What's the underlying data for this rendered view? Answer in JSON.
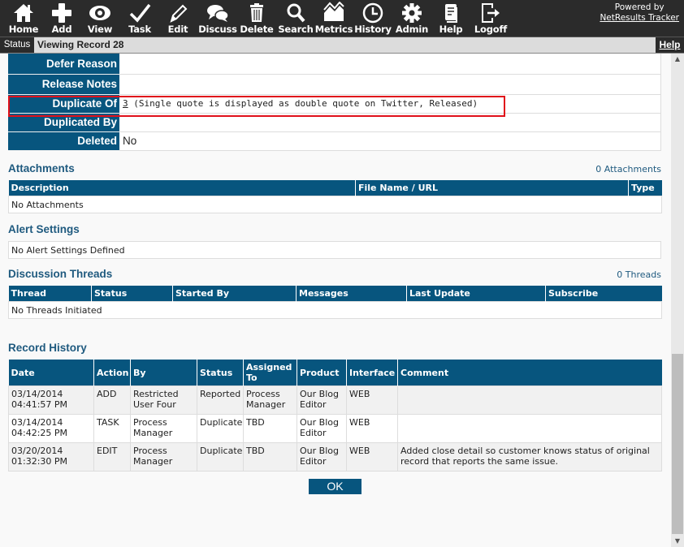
{
  "toolbar": {
    "items": [
      {
        "label": "Home",
        "icon": "home-icon"
      },
      {
        "label": "Add",
        "icon": "plus-icon"
      },
      {
        "label": "View",
        "icon": "eye-icon"
      },
      {
        "label": "Task",
        "icon": "checkmark-icon"
      },
      {
        "label": "Edit",
        "icon": "pencil-icon"
      },
      {
        "label": "Discuss",
        "icon": "chat-bubbles-icon"
      },
      {
        "label": "Delete",
        "icon": "trash-icon"
      },
      {
        "label": "Search",
        "icon": "magnifier-icon"
      },
      {
        "label": "Metrics",
        "icon": "chart-icon"
      },
      {
        "label": "History",
        "icon": "clock-icon"
      },
      {
        "label": "Admin",
        "icon": "gear-icon"
      },
      {
        "label": "Help",
        "icon": "document-icon"
      },
      {
        "label": "Logoff",
        "icon": "logout-icon"
      }
    ],
    "powered_by": "Powered by",
    "brand_link": "NetResults Tracker"
  },
  "statusbar": {
    "tag": "Status",
    "text": "Viewing Record 28",
    "help": "Help"
  },
  "fields": [
    {
      "label": "Defer Reason",
      "value": ""
    },
    {
      "label": "Release Notes",
      "value": ""
    },
    {
      "label": "Duplicate Of",
      "link": "3",
      "value": " (Single quote is displayed as double quote on Twitter, Released)"
    },
    {
      "label": "Duplicated By",
      "value": ""
    },
    {
      "label": "Deleted",
      "value": "No"
    }
  ],
  "attachments": {
    "title": "Attachments",
    "count": "0 Attachments",
    "columns": [
      "Description",
      "File Name / URL",
      "Type"
    ],
    "empty": "No Attachments"
  },
  "alerts": {
    "title": "Alert Settings",
    "empty": "No Alert Settings Defined"
  },
  "threads": {
    "title": "Discussion Threads",
    "count": "0 Threads",
    "columns": [
      "Thread",
      "Status",
      "Started By",
      "Messages",
      "Last Update",
      "Subscribe"
    ],
    "empty": "No Threads Initiated"
  },
  "history": {
    "title": "Record History",
    "columns": [
      "Date",
      "Action",
      "By",
      "Status",
      "Assigned To",
      "Product",
      "Interface",
      "Comment"
    ],
    "rows": [
      {
        "date": "03/14/2014 04:41:57 PM",
        "action": "ADD",
        "by": "Restricted User Four",
        "status": "Reported",
        "assigned": "Process Manager",
        "product": "Our Blog Editor",
        "interface": "WEB",
        "comment": ""
      },
      {
        "date": "03/14/2014 04:42:25 PM",
        "action": "TASK",
        "by": "Process Manager",
        "status": "Duplicate",
        "assigned": "TBD",
        "product": "Our Blog Editor",
        "interface": "WEB",
        "comment": ""
      },
      {
        "date": "03/20/2014 01:32:30 PM",
        "action": "EDIT",
        "by": "Process Manager",
        "status": "Duplicate",
        "assigned": "TBD",
        "product": "Our Blog Editor",
        "interface": "WEB",
        "comment": "Added close detail so customer knows status of original record that reports the same issue."
      }
    ]
  },
  "ok_label": "OK",
  "colors": {
    "header_blue": "#07557e",
    "toolbar_bg": "#2b2b2b",
    "highlight": "#e0101a",
    "section_title": "#1f5a7f"
  }
}
